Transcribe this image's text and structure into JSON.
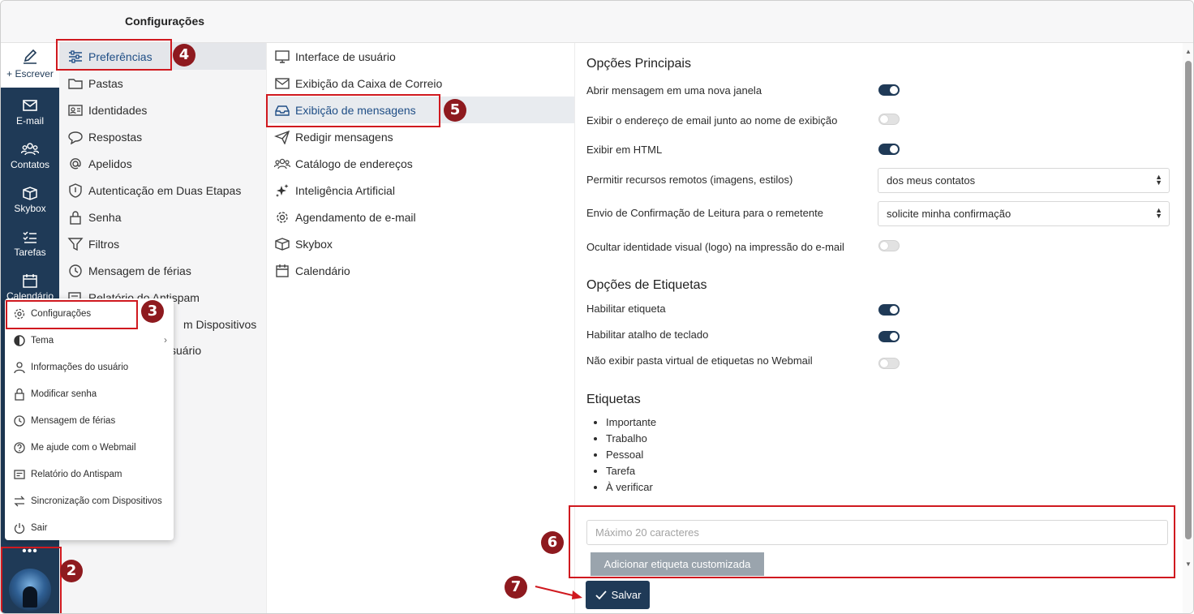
{
  "header": {
    "title": "Configurações"
  },
  "rail": {
    "compose_label": "+ Escrever",
    "items": [
      {
        "label": "E-mail",
        "icon": "mail-icon"
      },
      {
        "label": "Contatos",
        "icon": "contacts-icon"
      },
      {
        "label": "Skybox",
        "icon": "box-icon"
      },
      {
        "label": "Tarefas",
        "icon": "tasks-icon"
      },
      {
        "label": "Calendário",
        "icon": "calendar-icon"
      }
    ],
    "more": "•••"
  },
  "settings_nav": {
    "items": [
      {
        "label": "Preferências",
        "icon": "sliders-icon"
      },
      {
        "label": "Pastas",
        "icon": "folder-icon"
      },
      {
        "label": "Identidades",
        "icon": "id-card-icon"
      },
      {
        "label": "Respostas",
        "icon": "chat-icon"
      },
      {
        "label": "Apelidos",
        "icon": "at-icon"
      },
      {
        "label": "Autenticação em Duas Etapas",
        "icon": "shield-icon"
      },
      {
        "label": "Senha",
        "icon": "lock-icon"
      },
      {
        "label": "Filtros",
        "icon": "filter-icon"
      },
      {
        "label": "Mensagem de férias",
        "icon": "clock-icon"
      },
      {
        "label": "Relatório do Antispam",
        "icon": "report-icon"
      },
      {
        "label": "m Dispositivos"
      },
      {
        "label": "suário"
      }
    ]
  },
  "section_nav": {
    "items": [
      {
        "label": "Interface de usuário",
        "icon": "monitor-icon"
      },
      {
        "label": "Exibição da Caixa de Correio",
        "icon": "envelope-icon"
      },
      {
        "label": "Exibição de mensagens",
        "icon": "inbox-icon"
      },
      {
        "label": "Redigir mensagens",
        "icon": "send-icon"
      },
      {
        "label": "Catálogo de endereços",
        "icon": "people-icon"
      },
      {
        "label": "Inteligência Artificial",
        "icon": "sparkle-icon"
      },
      {
        "label": "Agendamento de e-mail",
        "icon": "gear-icon"
      },
      {
        "label": "Skybox",
        "icon": "box-icon"
      },
      {
        "label": "Calendário",
        "icon": "calendar-icon"
      }
    ]
  },
  "content": {
    "main_title": "Opções Principais",
    "main_options": [
      {
        "label": "Abrir mensagem em uma nova janela",
        "state": "on"
      },
      {
        "label": "Exibir o endereço de email junto ao nome de exibição",
        "state": "off"
      },
      {
        "label": "Exibir em HTML",
        "state": "on"
      },
      {
        "label": "Permitir recursos remotos (imagens, estilos)",
        "value": "dos meus contatos"
      },
      {
        "label": "Envio de Confirmação de Leitura para o remetente",
        "value": "solicite minha confirmação"
      },
      {
        "label": "Ocultar identidade visual (logo) na impressão do e-mail",
        "state": "off"
      }
    ],
    "tags_title": "Opções de Etiquetas",
    "tag_options": [
      {
        "label": "Habilitar etiqueta",
        "state": "on"
      },
      {
        "label": "Habilitar atalho de teclado",
        "state": "on"
      },
      {
        "label": "Não exibir pasta virtual de etiquetas no Webmail",
        "state": "off"
      }
    ],
    "labels_title": "Etiquetas",
    "labels": [
      "Importante",
      "Trabalho",
      "Pessoal",
      "Tarefa",
      "À verificar"
    ],
    "tag_input_placeholder": "Máximo 20 caracteres",
    "add_tag_label": "Adicionar etiqueta customizada",
    "save_label": "Salvar"
  },
  "popup": {
    "items": [
      {
        "label": "Configurações",
        "icon": "gear-icon"
      },
      {
        "label": "Tema",
        "icon": "contrast-icon",
        "submenu": "›"
      },
      {
        "label": "Informações do usuário",
        "icon": "user-icon"
      },
      {
        "label": "Modificar senha",
        "icon": "lock-icon"
      },
      {
        "label": "Mensagem de férias",
        "icon": "clock-icon"
      },
      {
        "label": "Me ajude com o Webmail",
        "icon": "help-icon"
      },
      {
        "label": "Relatório do Antispam",
        "icon": "report-icon"
      },
      {
        "label": "Sincronização com Dispositivos",
        "icon": "sync-icon"
      },
      {
        "label": "Sair",
        "icon": "power-icon"
      }
    ]
  },
  "annotations": [
    "2",
    "3",
    "4",
    "5",
    "6",
    "7"
  ],
  "colors": {
    "accent": "#1f3a57",
    "highlight": "#d0191f",
    "badge": "#8e1a1f",
    "link": "#1f4e86"
  }
}
